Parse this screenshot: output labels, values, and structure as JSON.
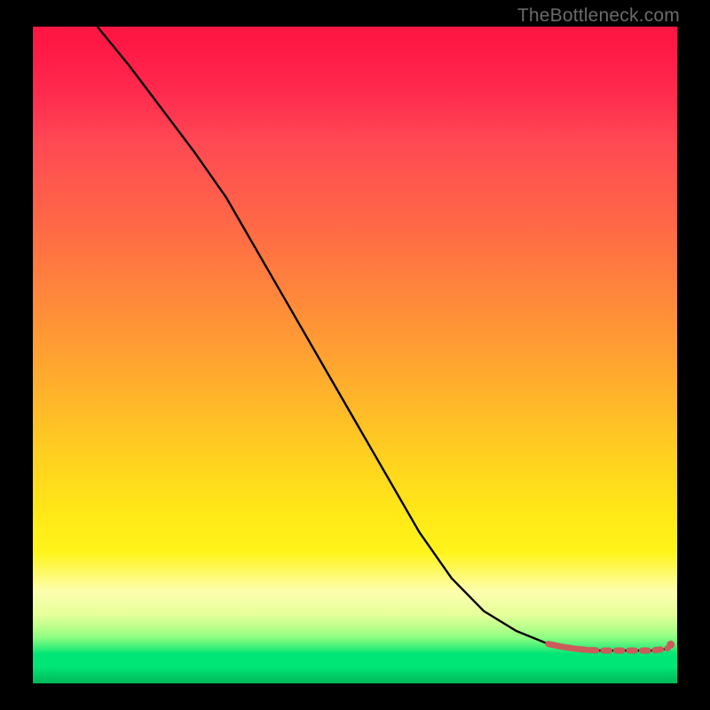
{
  "watermark": "TheBottleneck.com",
  "colors": {
    "gradient_top": "#ff1744",
    "gradient_mid1": "#ff8a3a",
    "gradient_mid2": "#ffe817",
    "gradient_bottom": "#00e676",
    "curve": "#000000",
    "marker": "#cc5b5b",
    "frame": "#000000"
  },
  "chart_data": {
    "type": "line",
    "title": "",
    "xlabel": "",
    "ylabel": "",
    "xlim": [
      0,
      100
    ],
    "ylim": [
      0,
      100
    ],
    "series": [
      {
        "name": "curve",
        "x": [
          10,
          15,
          20,
          25,
          30,
          35,
          40,
          45,
          50,
          55,
          60,
          65,
          70,
          75,
          80,
          82,
          84,
          86,
          88,
          90,
          92,
          94,
          96,
          98,
          99
        ],
        "y": [
          100,
          94,
          87.5,
          81,
          74,
          65.5,
          57,
          48.5,
          40,
          31.5,
          23,
          16,
          11,
          8,
          6,
          5.6,
          5.3,
          5.1,
          5,
          5,
          5,
          5,
          5,
          5.2,
          5.5
        ]
      }
    ],
    "markers": {
      "name": "flat-region",
      "x": [
        80,
        82,
        84,
        86,
        88,
        90,
        92,
        94,
        96,
        98,
        99
      ],
      "y": [
        6,
        5.6,
        5.3,
        5.1,
        5,
        5,
        5,
        5,
        5,
        5.2,
        5.5
      ]
    }
  }
}
